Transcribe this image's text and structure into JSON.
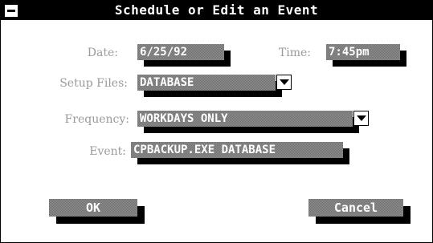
{
  "window": {
    "title": "Schedule or Edit an Event"
  },
  "form": {
    "date_label": "Date:",
    "date_value": "6/25/92",
    "time_label": "Time:",
    "time_value": "7:45pm",
    "setup_files_label": "Setup Files:",
    "setup_files_value": "DATABASE",
    "frequency_label": "Frequency:",
    "frequency_value": "WORKDAYS ONLY",
    "event_label": "Event:",
    "event_value": "CPBACKUP.EXE DATABASE"
  },
  "buttons": {
    "ok_label": "OK",
    "cancel_label": "Cancel"
  },
  "icons": {
    "system_menu": "system-menu-icon",
    "dropdown": "chevron-down-icon"
  },
  "colors": {
    "title_bar": "#000000",
    "label_text": "#9a9a9a",
    "field_fill": "#8c8c8c",
    "shadow": "#000000"
  }
}
